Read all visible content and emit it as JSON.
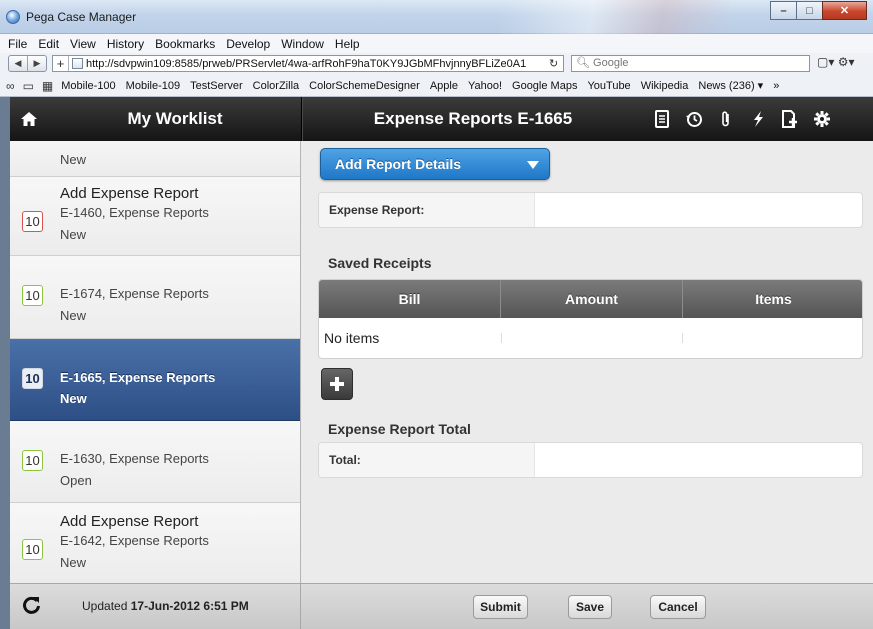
{
  "window": {
    "title": "Pega Case Manager"
  },
  "menubar": [
    "File",
    "Edit",
    "View",
    "History",
    "Bookmarks",
    "Develop",
    "Window",
    "Help"
  ],
  "toolbar": {
    "url": "http://sdvpwin109:8585/prweb/PRServlet/4wa-arfRohF9haT0KY9JGbMFhvjnnyBFLiZe0A1",
    "search_placeholder": "Google"
  },
  "bookmarks": [
    "Mobile-100",
    "Mobile-109",
    "TestServer",
    "ColorZilla",
    "ColorSchemeDesigner",
    "Apple",
    "Yahoo!",
    "Google Maps",
    "YouTube",
    "Wikipedia",
    "News (236) ▾"
  ],
  "header": {
    "worklist_title": "My Worklist",
    "case_title": "Expense Reports E-1665"
  },
  "worklist": {
    "items": [
      {
        "title": "",
        "case": "",
        "status": "New",
        "badge": ""
      },
      {
        "title": "Add Expense Report",
        "case": "E-1460, Expense Reports",
        "status": "New",
        "badge": "10"
      },
      {
        "title": "",
        "case": "E-1674, Expense Reports",
        "status": "New",
        "badge": "10"
      },
      {
        "title": "",
        "case": "E-1665, Expense Reports",
        "status": "New",
        "badge": "10"
      },
      {
        "title": "",
        "case": "E-1630, Expense Reports",
        "status": "Open",
        "badge": "10"
      },
      {
        "title": "Add Expense Report",
        "case": "E-1642, Expense Reports",
        "status": "New",
        "badge": "10"
      }
    ]
  },
  "content": {
    "section_button": "Add Report Details",
    "expense_report_label": "Expense Report:",
    "saved_receipts_title": "Saved Receipts",
    "grid_columns": [
      "Bill",
      "Amount",
      "Items"
    ],
    "grid_empty": "No items",
    "total_title": "Expense Report Total",
    "total_label": "Total:"
  },
  "footer": {
    "updated_prefix": "Updated",
    "updated_time": "17-Jun-2012 6:51 PM",
    "submit_label": "Submit",
    "save_label": "Save",
    "cancel_label": "Cancel"
  },
  "colors": {
    "accent_blue": "#1f78c8",
    "selected_item": "#2d4f86",
    "header_dark": "#151515",
    "badge_green": "#8cc63f",
    "badge_red": "#d9534f"
  }
}
